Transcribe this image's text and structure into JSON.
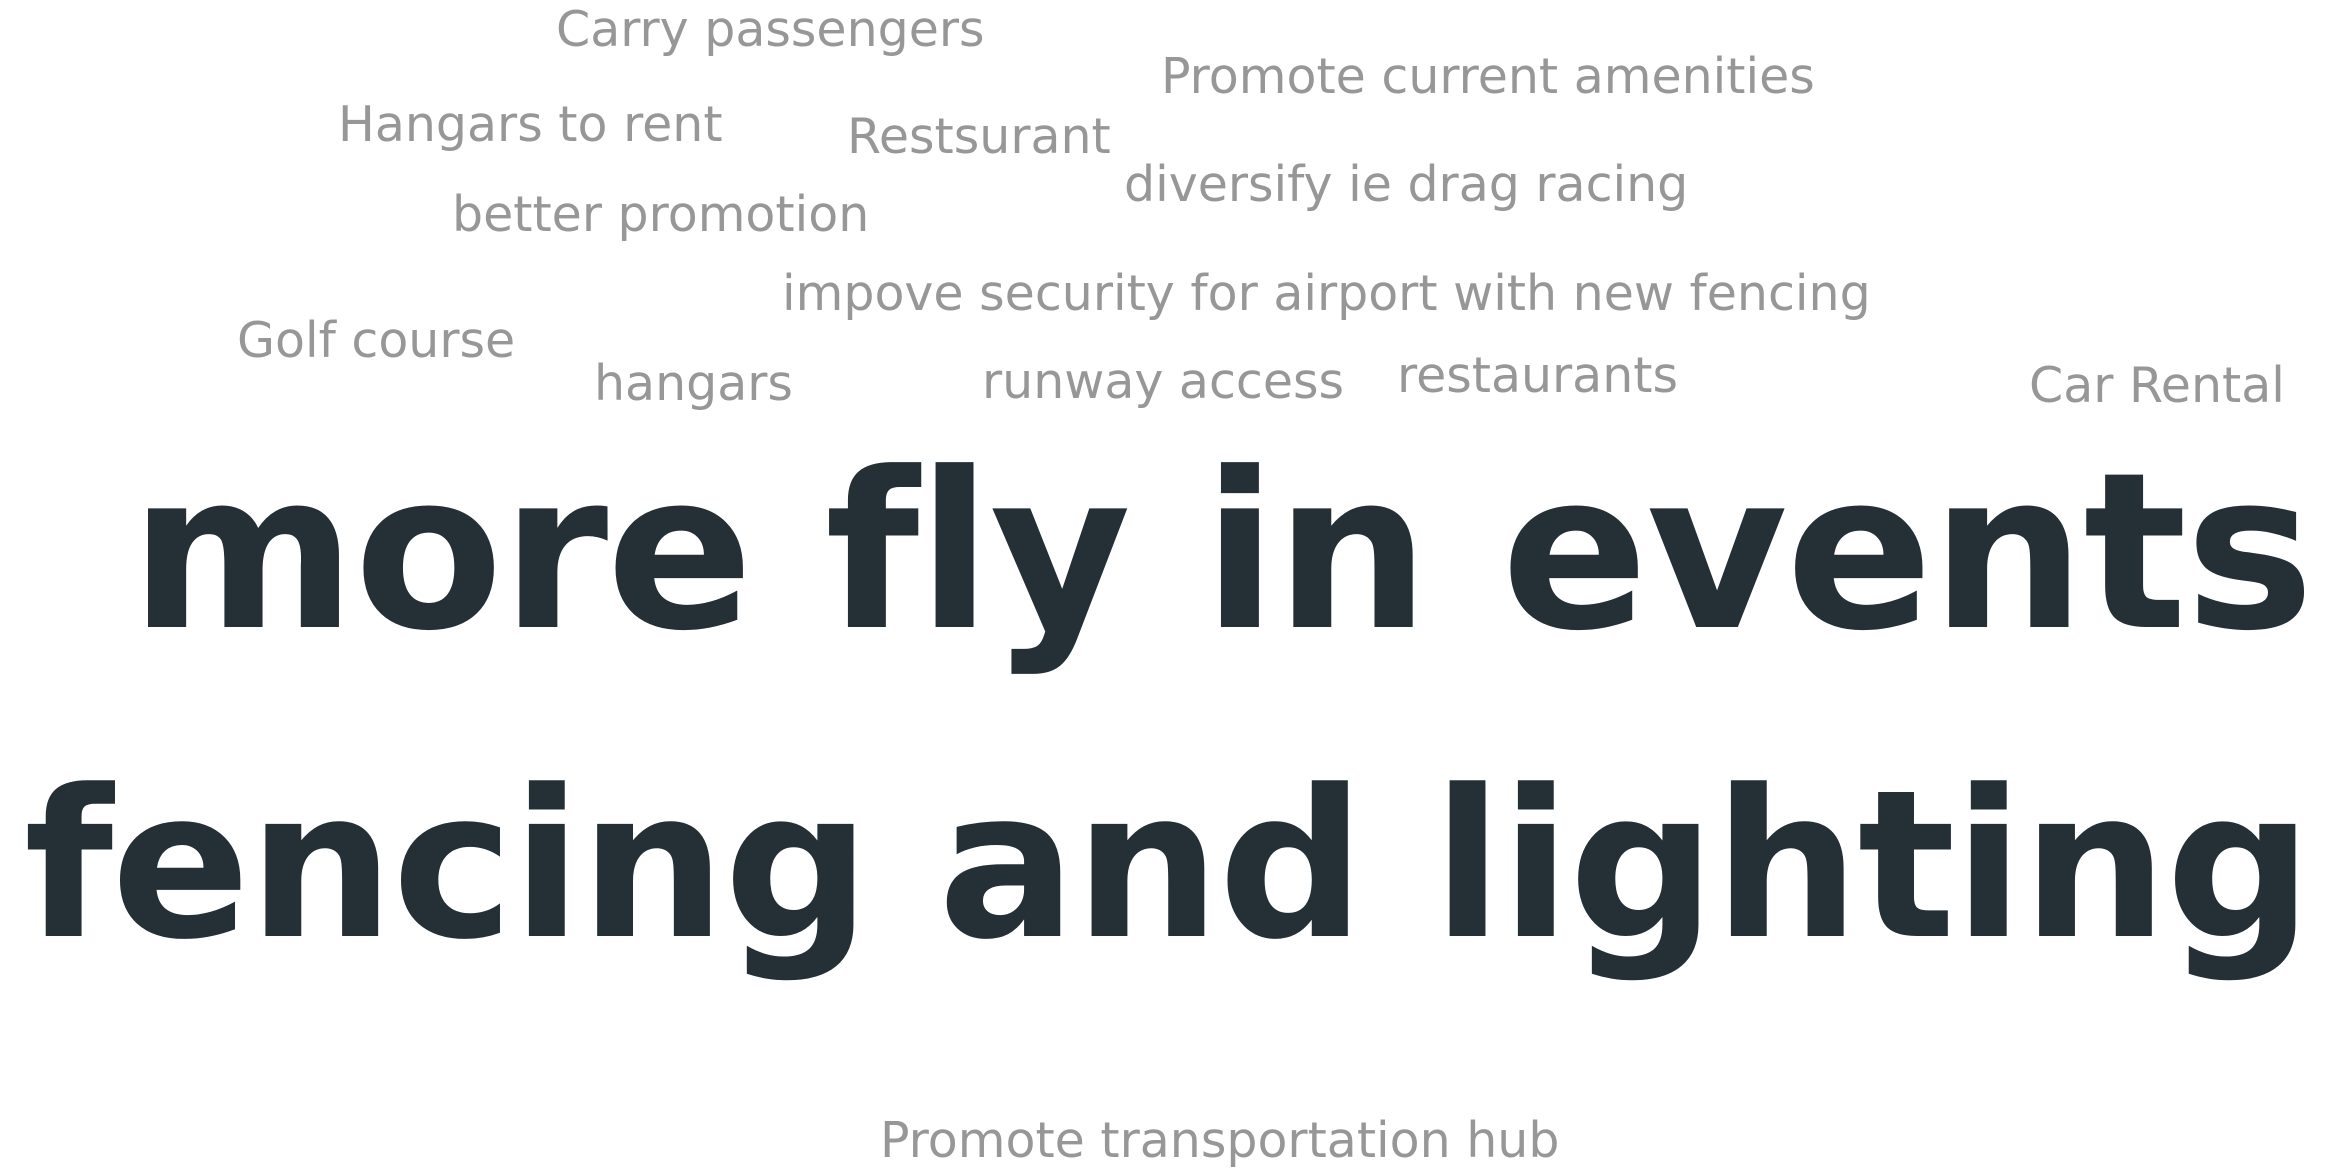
{
  "cloud": {
    "words": [
      {
        "id": "carry-passengers",
        "text": "Carry passengers",
        "weight": 1
      },
      {
        "id": "promote-current-amenities",
        "text": "Promote current amenities",
        "weight": 1
      },
      {
        "id": "hangars-to-rent",
        "text": "Hangars to rent",
        "weight": 1
      },
      {
        "id": "restsurant",
        "text": "Restsurant",
        "weight": 1
      },
      {
        "id": "diversify-drag-racing",
        "text": "diversify ie drag racing",
        "weight": 1
      },
      {
        "id": "better-promotion",
        "text": "better promotion",
        "weight": 1
      },
      {
        "id": "impove-security",
        "text": "impove security for airport with new fencing",
        "weight": 1
      },
      {
        "id": "golf-course",
        "text": "Golf course",
        "weight": 1
      },
      {
        "id": "hangars",
        "text": "hangars",
        "weight": 1
      },
      {
        "id": "runway-access",
        "text": "runway access",
        "weight": 1
      },
      {
        "id": "restaurants",
        "text": "restaurants",
        "weight": 1
      },
      {
        "id": "car-rental",
        "text": "Car Rental",
        "weight": 1
      },
      {
        "id": "more-fly-in-events",
        "text": "more fly in events",
        "weight": 10
      },
      {
        "id": "fencing-and-lighting",
        "text": "fencing and lighting",
        "weight": 10
      },
      {
        "id": "promote-transportation-hub",
        "text": "Promote transportation hub",
        "weight": 1
      }
    ],
    "colors": {
      "primary": "#252f36",
      "secondary": "#979797",
      "background": "#ffffff"
    }
  }
}
